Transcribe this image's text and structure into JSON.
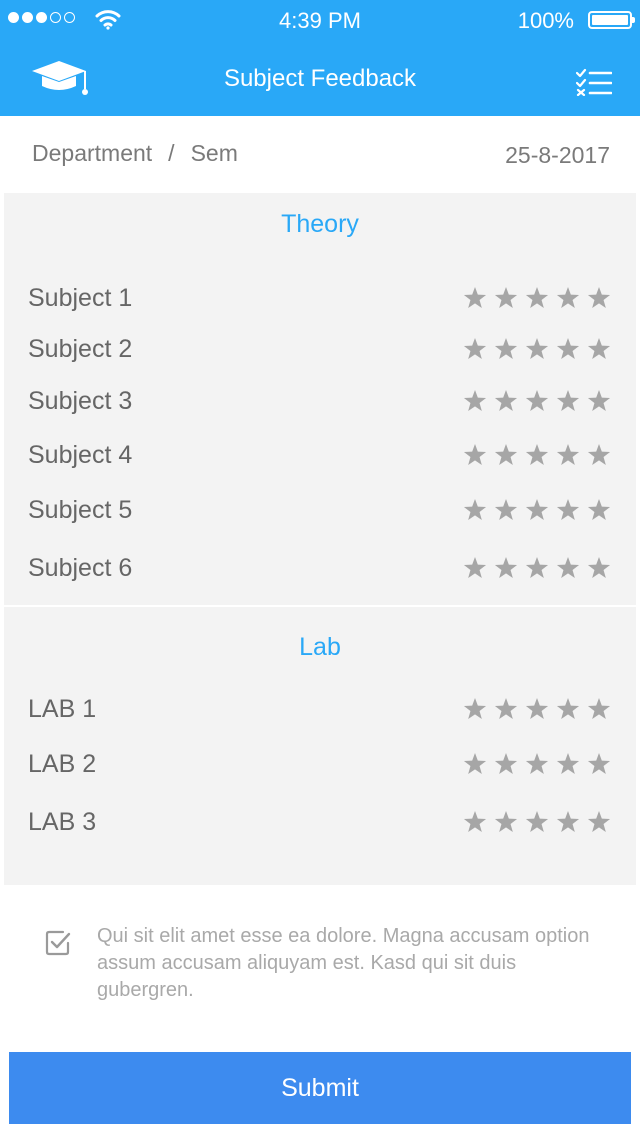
{
  "status_bar": {
    "time": "4:39 PM",
    "battery": "100%"
  },
  "header": {
    "title": "Subject Feedback"
  },
  "info": {
    "department": "Department",
    "separator": "/",
    "semester": "Sem",
    "date": "25-8-2017"
  },
  "theory": {
    "title": "Theory",
    "subjects": [
      {
        "label": "Subject 1",
        "rating": 0
      },
      {
        "label": "Subject 2",
        "rating": 0
      },
      {
        "label": "Subject 3",
        "rating": 0
      },
      {
        "label": "Subject 4",
        "rating": 0
      },
      {
        "label": "Subject 5",
        "rating": 0
      },
      {
        "label": "Subject 6",
        "rating": 0
      }
    ]
  },
  "lab": {
    "title": "Lab",
    "subjects": [
      {
        "label": "LAB 1",
        "rating": 0
      },
      {
        "label": "LAB 2",
        "rating": 0
      },
      {
        "label": "LAB 3",
        "rating": 0
      }
    ]
  },
  "agreement": {
    "text": "Qui sit elit amet esse ea dolore. Magna accusam option assum accusam aliquyam est. Kasd qui sit duis gubergren."
  },
  "submit_label": "Submit",
  "colors": {
    "primary": "#29a8f7",
    "button": "#3d8bef",
    "panel": "#f3f3f3",
    "star": "#a6a6a6"
  },
  "icons": {
    "logo": "graduation-cap-icon",
    "menu": "checklist-icon",
    "star": "star-icon",
    "checkbox": "checkbox-checked-icon"
  }
}
